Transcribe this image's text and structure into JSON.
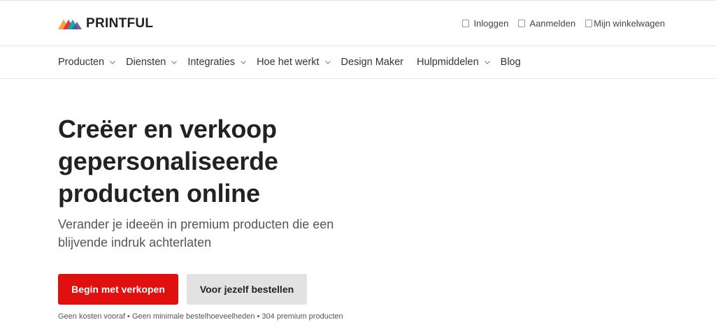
{
  "brand": {
    "name": "PRINTFUL",
    "colors": {
      "orange": "#f36f3f",
      "red": "#e7333f",
      "teal": "#17a7a0",
      "dark": "#222222"
    }
  },
  "account": {
    "login": "Inloggen",
    "signup": "Aanmelden",
    "cart": "Mijn winkelwagen"
  },
  "nav": {
    "items": [
      {
        "label": "Producten",
        "has_dropdown": true
      },
      {
        "label": "Diensten",
        "has_dropdown": true
      },
      {
        "label": "Integraties",
        "has_dropdown": true
      },
      {
        "label": "Hoe het werkt",
        "has_dropdown": true
      },
      {
        "label": "Design Maker",
        "has_dropdown": false
      },
      {
        "label": "Hulpmiddelen",
        "has_dropdown": true
      },
      {
        "label": "Blog",
        "has_dropdown": false
      }
    ]
  },
  "hero": {
    "title_line1": "Creëer en verkoop",
    "title_line2": "gepersonaliseerde",
    "title_line3": "producten online",
    "subtitle": "Verander je ideeën in premium producten die een blijvende indruk achterlaten",
    "primary_button": "Begin met verkopen",
    "secondary_button": "Voor jezelf bestellen",
    "footnote": "Geen kosten vooraf • Geen minimale bestelhoeveelheden • 304 premium producten"
  },
  "colors": {
    "primary_button": "#e10f0f",
    "secondary_button": "#e2e2e2"
  }
}
